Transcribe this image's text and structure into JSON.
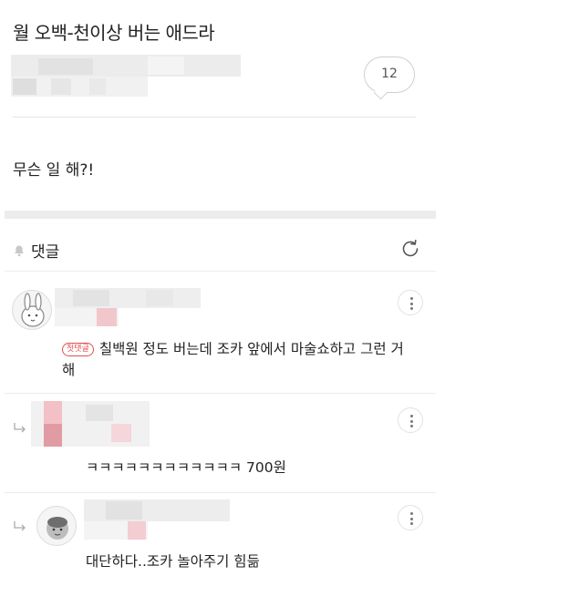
{
  "post": {
    "title": "월 오백-천이상 버는 애드라",
    "comment_count": "12",
    "body": "무슨 일 해?!"
  },
  "comments_section": {
    "header_label": "댓글",
    "icons": {
      "bell": "bell-icon",
      "refresh": "refresh-icon",
      "more": "more-vertical-icon",
      "reply": "reply-arrow-icon"
    }
  },
  "comments": [
    {
      "badge": "첫댓글",
      "text": "칠백원 정도 버는데 조카 앞에서 마술쇼하고 그런 거 해",
      "is_reply": false
    },
    {
      "badge": "",
      "text": "ㅋㅋㅋㅋㅋㅋㅋㅋㅋㅋㅋㅋ 700원",
      "is_reply": true
    },
    {
      "badge": "",
      "text": "대단하다..조카 놀아주기 힘듦",
      "is_reply": true
    }
  ],
  "colors": {
    "badge_red": "#e05050",
    "divider": "#ececec",
    "blur_pink": "#e8a7ae"
  }
}
